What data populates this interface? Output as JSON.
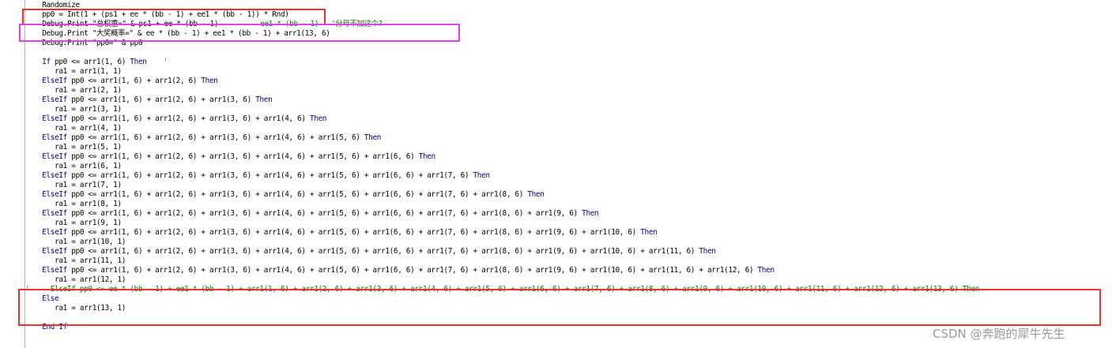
{
  "editor": {
    "lines": [
      {
        "indent": "    ",
        "parts": [
          {
            "t": "Randomize",
            "c": "code"
          }
        ]
      },
      {
        "indent": "    ",
        "parts": [
          {
            "t": "pp0 = Int(1 + (ps1 + ee * (bb - 1) + ee1 * (bb - 1)) * Rnd)",
            "c": "code"
          }
        ]
      },
      {
        "indent": "    ",
        "parts": [
          {
            "t": "Debug.Print \"总权重=\" & ps1 + ee * (bb - 1)",
            "c": "code"
          },
          {
            "t": "          ee1 * (bb - 1)   '分母不加这个?",
            "c": "cm"
          }
        ]
      },
      {
        "indent": "    ",
        "parts": [
          {
            "t": "Debug.Print \"大奖概率=\" & ee * (bb - 1) + ee1 * (bb - 1) + arr1(13, 6)",
            "c": "code"
          }
        ]
      },
      {
        "indent": "    ",
        "parts": [
          {
            "t": "Debug.Print \"pp0=\" & pp0",
            "c": "code"
          }
        ]
      },
      {
        "indent": "",
        "parts": []
      },
      {
        "indent": "    ",
        "parts": [
          {
            "t": "If",
            "c": "kw"
          },
          {
            "t": " pp0 <= arr1(1, 6) ",
            "c": "code"
          },
          {
            "t": "Then",
            "c": "kw"
          },
          {
            "t": "    '",
            "c": "cm"
          }
        ]
      },
      {
        "indent": "       ",
        "parts": [
          {
            "t": "ra1 = arr1(1, 1)",
            "c": "code"
          }
        ]
      },
      {
        "indent": "    ",
        "parts": [
          {
            "t": "ElseIf",
            "c": "kw"
          },
          {
            "t": " pp0 <= arr1(1, 6) + arr1(2, 6) ",
            "c": "code"
          },
          {
            "t": "Then",
            "c": "kw"
          }
        ]
      },
      {
        "indent": "       ",
        "parts": [
          {
            "t": "ra1 = arr1(2, 1)",
            "c": "code"
          }
        ]
      },
      {
        "indent": "    ",
        "parts": [
          {
            "t": "ElseIf",
            "c": "kw"
          },
          {
            "t": " pp0 <= arr1(1, 6) + arr1(2, 6) + arr1(3, 6) ",
            "c": "code"
          },
          {
            "t": "Then",
            "c": "kw"
          }
        ]
      },
      {
        "indent": "       ",
        "parts": [
          {
            "t": "ra1 = arr1(3, 1)",
            "c": "code"
          }
        ]
      },
      {
        "indent": "    ",
        "parts": [
          {
            "t": "ElseIf",
            "c": "kw"
          },
          {
            "t": " pp0 <= arr1(1, 6) + arr1(2, 6) + arr1(3, 6) + arr1(4, 6) ",
            "c": "code"
          },
          {
            "t": "Then",
            "c": "kw"
          }
        ]
      },
      {
        "indent": "       ",
        "parts": [
          {
            "t": "ra1 = arr1(4, 1)",
            "c": "code"
          }
        ]
      },
      {
        "indent": "    ",
        "parts": [
          {
            "t": "ElseIf",
            "c": "kw"
          },
          {
            "t": " pp0 <= arr1(1, 6) + arr1(2, 6) + arr1(3, 6) + arr1(4, 6) + arr1(5, 6) ",
            "c": "code"
          },
          {
            "t": "Then",
            "c": "kw"
          }
        ]
      },
      {
        "indent": "       ",
        "parts": [
          {
            "t": "ra1 = arr1(5, 1)",
            "c": "code"
          }
        ]
      },
      {
        "indent": "    ",
        "parts": [
          {
            "t": "ElseIf",
            "c": "kw"
          },
          {
            "t": " pp0 <= arr1(1, 6) + arr1(2, 6) + arr1(3, 6) + arr1(4, 6) + arr1(5, 6) + arr1(6, 6) ",
            "c": "code"
          },
          {
            "t": "Then",
            "c": "kw"
          }
        ]
      },
      {
        "indent": "       ",
        "parts": [
          {
            "t": "ra1 = arr1(6, 1)",
            "c": "code"
          }
        ]
      },
      {
        "indent": "    ",
        "parts": [
          {
            "t": "ElseIf",
            "c": "kw"
          },
          {
            "t": " pp0 <= arr1(1, 6) + arr1(2, 6) + arr1(3, 6) + arr1(4, 6) + arr1(5, 6) + arr1(6, 6) + arr1(7, 6) ",
            "c": "code"
          },
          {
            "t": "Then",
            "c": "kw"
          }
        ]
      },
      {
        "indent": "       ",
        "parts": [
          {
            "t": "ra1 = arr1(7, 1)",
            "c": "code"
          }
        ]
      },
      {
        "indent": "    ",
        "parts": [
          {
            "t": "ElseIf",
            "c": "kw"
          },
          {
            "t": " pp0 <= arr1(1, 6) + arr1(2, 6) + arr1(3, 6) + arr1(4, 6) + arr1(5, 6) + arr1(6, 6) + arr1(7, 6) + arr1(8, 6) ",
            "c": "code"
          },
          {
            "t": "Then",
            "c": "kw"
          }
        ]
      },
      {
        "indent": "       ",
        "parts": [
          {
            "t": "ra1 = arr1(8, 1)",
            "c": "code"
          }
        ]
      },
      {
        "indent": "    ",
        "parts": [
          {
            "t": "ElseIf",
            "c": "kw"
          },
          {
            "t": " pp0 <= arr1(1, 6) + arr1(2, 6) + arr1(3, 6) + arr1(4, 6) + arr1(5, 6) + arr1(6, 6) + arr1(7, 6) + arr1(8, 6) + arr1(9, 6) ",
            "c": "code"
          },
          {
            "t": "Then",
            "c": "kw"
          }
        ]
      },
      {
        "indent": "       ",
        "parts": [
          {
            "t": "ra1 = arr1(9, 1)",
            "c": "code"
          }
        ]
      },
      {
        "indent": "    ",
        "parts": [
          {
            "t": "ElseIf",
            "c": "kw"
          },
          {
            "t": " pp0 <= arr1(1, 6) + arr1(2, 6) + arr1(3, 6) + arr1(4, 6) + arr1(5, 6) + arr1(6, 6) + arr1(7, 6) + arr1(8, 6) + arr1(9, 6) + arr1(10, 6) ",
            "c": "code"
          },
          {
            "t": "Then",
            "c": "kw"
          }
        ]
      },
      {
        "indent": "       ",
        "parts": [
          {
            "t": "ra1 = arr1(10, 1)",
            "c": "code"
          }
        ]
      },
      {
        "indent": "    ",
        "parts": [
          {
            "t": "ElseIf",
            "c": "kw"
          },
          {
            "t": " pp0 <= arr1(1, 6) + arr1(2, 6) + arr1(3, 6) + arr1(4, 6) + arr1(5, 6) + arr1(6, 6) + arr1(7, 6) + arr1(8, 6) + arr1(9, 6) + arr1(10, 6) + arr1(11, 6) ",
            "c": "code"
          },
          {
            "t": "Then",
            "c": "kw"
          }
        ]
      },
      {
        "indent": "       ",
        "parts": [
          {
            "t": "ra1 = arr1(11, 1)",
            "c": "code"
          }
        ]
      },
      {
        "indent": "    ",
        "parts": [
          {
            "t": "ElseIf",
            "c": "kw"
          },
          {
            "t": " pp0 <= arr1(1, 6) + arr1(2, 6) + arr1(3, 6) + arr1(4, 6) + arr1(5, 6) + arr1(6, 6) + arr1(7, 6) + arr1(8, 6) + arr1(9, 6) + arr1(10, 6) + arr1(11, 6) + arr1(12, 6) ",
            "c": "code"
          },
          {
            "t": "Then",
            "c": "kw"
          }
        ]
      },
      {
        "indent": "       ",
        "parts": [
          {
            "t": "ra1 = arr1(12, 1)",
            "c": "code"
          }
        ]
      },
      {
        "indent": "",
        "parts": [
          {
            "t": "'     ElseIf pp0 <= ee * (bb - 1) + ee1 * (bb - 1) + arr1(1, 6) + arr1(2, 6) + arr1(3, 6) + arr1(4, 6) + arr1(5, 6) + arr1(6, 6) + arr1(7, 6) + arr1(8, 6) + arr1(9, 6) + arr1(10, 6) + arr1(11, 6) + arr1(12, 6) + arr1(13, 6) Then",
            "c": "cm"
          }
        ]
      },
      {
        "indent": "    ",
        "parts": [
          {
            "t": "Else",
            "c": "kw"
          }
        ]
      },
      {
        "indent": "       ",
        "parts": [
          {
            "t": "ra1 = arr1(13, 1)",
            "c": "code"
          }
        ]
      },
      {
        "indent": "",
        "parts": []
      },
      {
        "indent": "    ",
        "parts": [
          {
            "t": "End If",
            "c": "kw"
          }
        ]
      }
    ]
  },
  "watermark": "CSDN @奔跑的犀牛先生",
  "colors": {
    "keyword": "#00007f",
    "comment": "#007f00",
    "highlight_red": "#e8302f",
    "highlight_pink": "#e040e8"
  }
}
